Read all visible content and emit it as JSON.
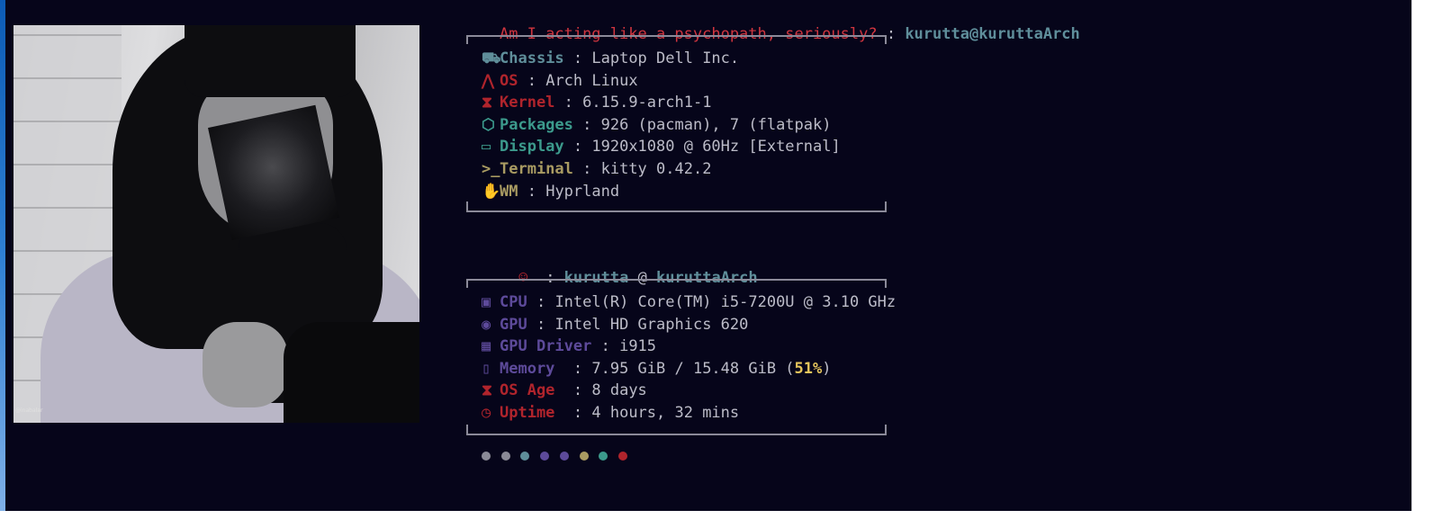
{
  "prompt": {
    "text": "Am I acting like a psychopath, seriously?",
    "separator": " : ",
    "userhost": "kurutta@kuruttaArch"
  },
  "photo": {
    "credit": "@inabalar"
  },
  "section1": [
    {
      "icon": "⛟",
      "icon_name": "chassis-icon",
      "label": "Chassis",
      "sep": " : ",
      "value": "Laptop Dell Inc.",
      "color": "#5f8e9a"
    },
    {
      "icon": "⋀",
      "icon_name": "arch-logo-icon",
      "label": "OS",
      "sep": " : ",
      "value": "Arch Linux",
      "color": "#b0242c"
    },
    {
      "icon": "⧗",
      "icon_name": "hourglass-icon",
      "label": "Kernel",
      "sep": " : ",
      "value": "6.15.9-arch1-1",
      "color": "#b0242c"
    },
    {
      "icon": "⬡",
      "icon_name": "package-icon",
      "label": "Packages",
      "sep": " : ",
      "value": "926 (pacman), 7 (flatpak)",
      "color": "#3c9a8c"
    },
    {
      "icon": "▭",
      "icon_name": "monitor-icon",
      "label": "Display",
      "sep": " : ",
      "value": "1920x1080 @ 60Hz [External]",
      "color": "#3c9a8c"
    },
    {
      "icon": ">_",
      "icon_name": "terminal-icon",
      "label": "Terminal",
      "sep": " : ",
      "value": "kitty 0.42.2",
      "color": "#a99b62"
    },
    {
      "icon": "✋",
      "icon_name": "hand-icon",
      "label": "WM",
      "sep": " : ",
      "value": "Hyprland",
      "color": "#a99b62"
    }
  ],
  "user_line": {
    "icon": "☺",
    "icon_name": "user-icon",
    "sep": " : ",
    "user": "kurutta",
    "at": " @ ",
    "host": "kuruttaArch",
    "icon_color": "#b0242c",
    "text_color": "#5f8e9a"
  },
  "section2": [
    {
      "icon": "▣",
      "icon_name": "cpu-icon",
      "label": "CPU",
      "sep": " : ",
      "value": "Intel(R) Core(TM) i5-7200U @ 3.10 GHz",
      "color": "#5d4a9a"
    },
    {
      "icon": "◉",
      "icon_name": "gamepad-icon",
      "label": "GPU",
      "sep": " : ",
      "value": "Intel HD Graphics 620",
      "color": "#5d4a9a"
    },
    {
      "icon": "▦",
      "icon_name": "grid-icon",
      "label": "GPU Driver",
      "sep": " : ",
      "value": "i915",
      "color": "#5d4a9a"
    },
    {
      "icon": "▯",
      "icon_name": "memory-icon",
      "label": "Memory ",
      "sep": " : ",
      "value": "7.95 GiB / 15.48 GiB (",
      "highlight": "51%",
      "value_after": ")",
      "color": "#5d4a9a"
    },
    {
      "icon": "⧗",
      "icon_name": "hourglass-icon",
      "label": "OS Age ",
      "sep": " : ",
      "value": "8 days",
      "color": "#b0242c"
    },
    {
      "icon": "◷",
      "icon_name": "timer-icon",
      "label": "Uptime ",
      "sep": " : ",
      "value": "4 hours, 32 mins",
      "color": "#b0242c"
    }
  ],
  "palette": [
    "#8a8a96",
    "#8a8a96",
    "#5f8e9a",
    "#5d4a9a",
    "#5d4a9a",
    "#a99b62",
    "#3c9a8c",
    "#b0242c"
  ],
  "colors": {
    "background": "#06051a",
    "text": "#bcbcc8",
    "prompt": "#d0353f",
    "userhost": "#5f8e9a",
    "highlight": "#e6c65c",
    "border": "#8b8a99"
  }
}
